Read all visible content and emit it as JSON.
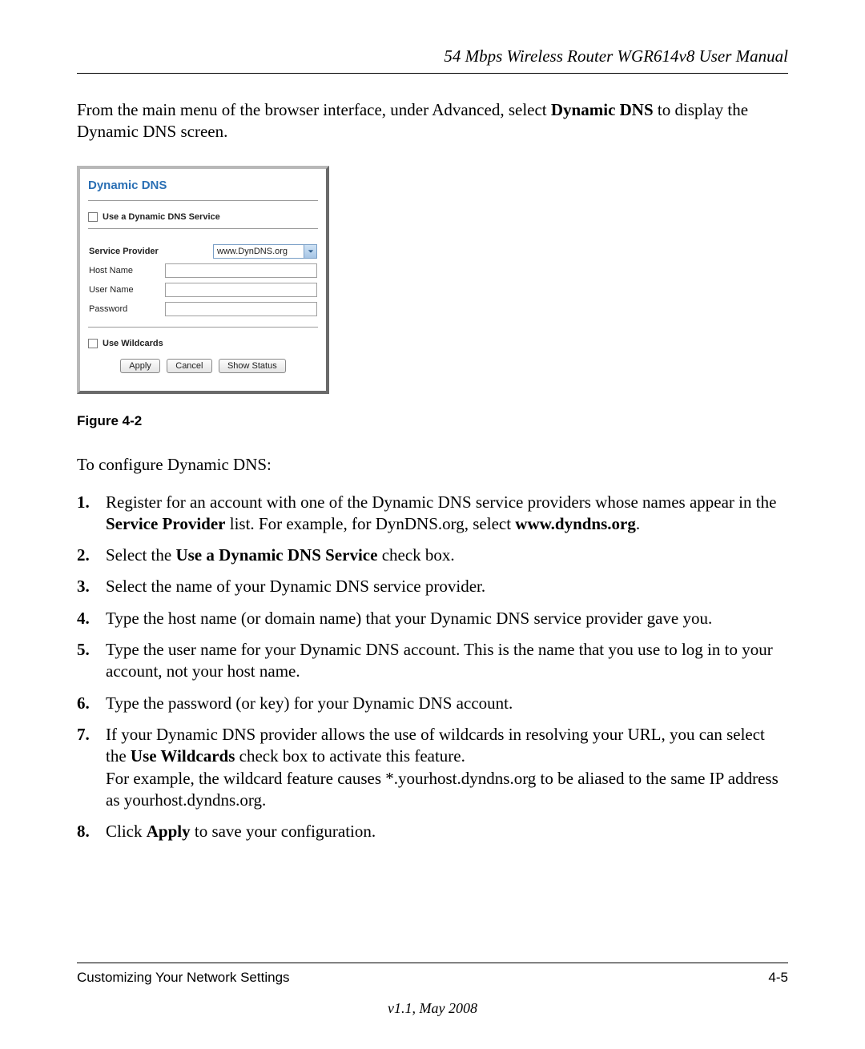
{
  "header": {
    "title": "54 Mbps Wireless Router WGR614v8 User Manual"
  },
  "intro": {
    "pre": "From the main menu of the browser interface, under Advanced, select ",
    "bold": "Dynamic DNS",
    "post": " to display the Dynamic DNS screen."
  },
  "panel": {
    "title": "Dynamic DNS",
    "use_service_label": "Use a Dynamic DNS Service",
    "service_provider_label": "Service Provider",
    "service_provider_value": "www.DynDNS.org",
    "host_name_label": "Host Name",
    "user_name_label": "User Name",
    "password_label": "Password",
    "use_wildcards_label": "Use Wildcards",
    "buttons": {
      "apply": "Apply",
      "cancel": "Cancel",
      "show_status": "Show Status"
    }
  },
  "figure_caption": "Figure 4-2",
  "configure_lead": "To configure Dynamic DNS:",
  "steps": {
    "s1_pre": "Register for an account with one of the Dynamic DNS service providers whose names appear in the ",
    "s1_b1": "Service Provider",
    "s1_mid": " list. For example, for DynDNS.org, select ",
    "s1_b2": "www.dyndns.org",
    "s1_post": ".",
    "s2_pre": "Select the ",
    "s2_b": "Use a Dynamic DNS Service",
    "s2_post": " check box.",
    "s3": "Select the name of your Dynamic DNS service provider.",
    "s4": "Type the host name (or domain name) that your Dynamic DNS service provider gave you.",
    "s5": "Type the user name for your Dynamic DNS account. This is the name that you use to log in to your account, not your host name.",
    "s6": "Type the password (or key) for your Dynamic DNS account.",
    "s7_pre": "If your Dynamic DNS provider allows the use of wildcards in resolving your URL, you can select the ",
    "s7_b": "Use Wildcards",
    "s7_mid": " check box to activate this feature.",
    "s7_line2": "For example, the wildcard feature causes *.yourhost.dyndns.org to be aliased to the same IP address as yourhost.dyndns.org.",
    "s8_pre": "Click ",
    "s8_b": "Apply",
    "s8_post": " to save your configuration."
  },
  "footer": {
    "section": "Customizing Your Network Settings",
    "page": "4-5",
    "version": "v1.1, May 2008"
  }
}
